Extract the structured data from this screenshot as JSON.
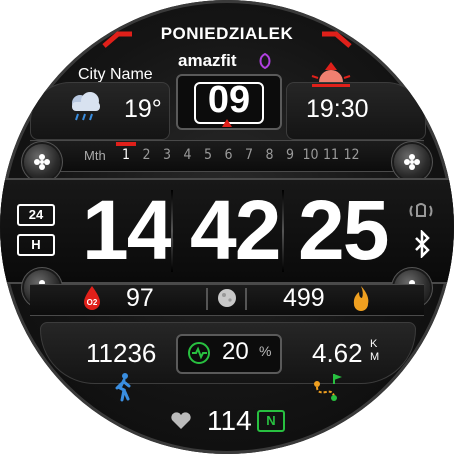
{
  "header": {
    "day": "PONIEDZIALEK",
    "brand": "amazfit",
    "city": "City Name"
  },
  "weather": {
    "temperature": "19°",
    "icon": "cloud-rain-icon"
  },
  "date_box": {
    "day_number": "09"
  },
  "sunset": {
    "time": "19:30",
    "icon": "sunset-icon"
  },
  "month_scale": {
    "label": "Mth",
    "months": [
      "1",
      "2",
      "3",
      "4",
      "5",
      "6",
      "7",
      "8",
      "9",
      "10",
      "11",
      "12"
    ],
    "current_month": 1
  },
  "time": {
    "hours": "14",
    "minutes": "42",
    "seconds": "25"
  },
  "left_badges": {
    "format": "24",
    "mode": "H"
  },
  "right_icons": [
    "vibrate-icon",
    "bluetooth-icon"
  ],
  "stats_row": {
    "spo2": "97",
    "spo2_icon_text": "O2",
    "moon_icon": "moon-phase-icon",
    "calories": "499",
    "calories_icon": "flame-icon"
  },
  "activity": {
    "steps": "11236",
    "battery_percent": "20",
    "percent_unit": "%",
    "distance": "4.62",
    "distance_unit_top": "K",
    "distance_unit_bottom": "M"
  },
  "heart": {
    "rate": "114",
    "zone_label": "N"
  },
  "colors": {
    "accent_red": "#e0201a",
    "accent_green": "#28c040",
    "accent_blue": "#3a8ee0",
    "accent_orange": "#f0a020"
  }
}
